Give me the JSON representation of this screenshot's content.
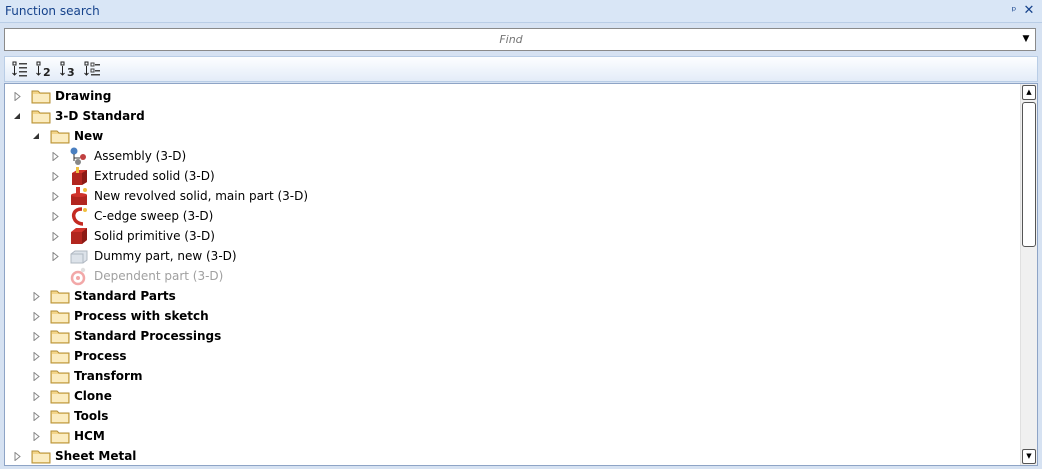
{
  "panel": {
    "title": "Function search",
    "pin_icon": "pin-icon",
    "close_icon": "close-icon"
  },
  "search": {
    "placeholder": "Find",
    "value": ""
  },
  "toolbar": {
    "buttons": [
      "sort-1-icon",
      "sort-2-icon",
      "sort-3-icon",
      "sort-4-icon"
    ]
  },
  "colors": {
    "folder": "#f3d58a",
    "accent": "#15428b",
    "part_red": "#d0332b"
  },
  "tree": {
    "drawing": "Drawing",
    "standard3d": "3-D Standard",
    "new": "New",
    "assembly": "Assembly (3-D)",
    "extruded": "Extruded solid (3-D)",
    "revolved": "New revolved solid, main part (3-D)",
    "cedge": "C-edge sweep (3-D)",
    "primitive": "Solid primitive (3-D)",
    "dummy": "Dummy part, new (3-D)",
    "dependent": "Dependent part (3-D)",
    "stdparts": "Standard Parts",
    "sketch": "Process with sketch",
    "stdproc": "Standard Processings",
    "process": "Process",
    "transform": "Transform",
    "clone": "Clone",
    "tools": "Tools",
    "hcm": "HCM",
    "sheetmetal": "Sheet Metal"
  }
}
